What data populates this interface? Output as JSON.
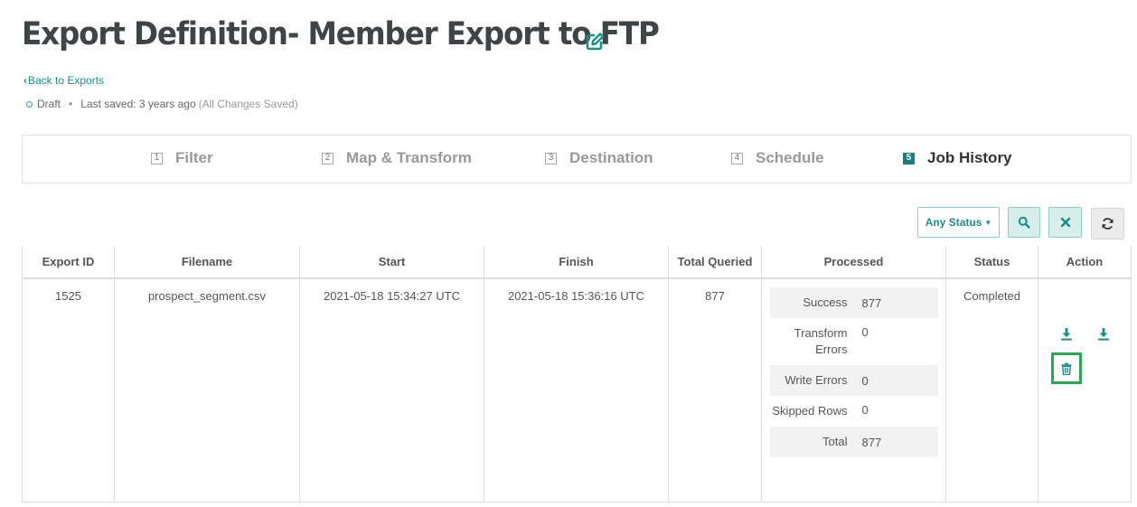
{
  "page": {
    "title": "Export Definition- Member Export to FTP",
    "edit_icon": "edit-icon"
  },
  "nav": {
    "back_label": "Back to Exports"
  },
  "meta": {
    "status": "Draft",
    "last_saved": "Last saved: 3 years ago",
    "saved_note": "(All Changes Saved)"
  },
  "steps": [
    {
      "num": "1",
      "label": "Filter"
    },
    {
      "num": "2",
      "label": "Map & Transform"
    },
    {
      "num": "3",
      "label": "Destination"
    },
    {
      "num": "4",
      "label": "Schedule"
    },
    {
      "num": "5",
      "label": "Job History",
      "active": true
    }
  ],
  "toolbar": {
    "status_filter": "Any Status",
    "search_icon": "search-icon",
    "clear_icon": "close-icon",
    "refresh_icon": "refresh-icon"
  },
  "table": {
    "headers": [
      "Export ID",
      "Filename",
      "Start",
      "Finish",
      "Total Queried",
      "Processed",
      "Status",
      "Action"
    ],
    "rows": [
      {
        "export_id": "1525",
        "filename": "prospect_segment.csv",
        "start": "2021-05-18 15:34:27 UTC",
        "finish": "2021-05-18 15:36:16 UTC",
        "total_queried": "877",
        "processed": [
          {
            "label": "Success",
            "value": "877"
          },
          {
            "label": "Transform Errors",
            "value": "0"
          },
          {
            "label": "Write Errors",
            "value": "0"
          },
          {
            "label": "Skipped Rows",
            "value": "0"
          },
          {
            "label": "Total",
            "value": "877"
          }
        ],
        "status": "Completed",
        "actions": [
          "download-icon",
          "download-icon",
          "trash-icon"
        ]
      }
    ]
  },
  "colors": {
    "accent": "#1a8f86",
    "active_step": "#17807a",
    "highlight": "#26a94f"
  }
}
